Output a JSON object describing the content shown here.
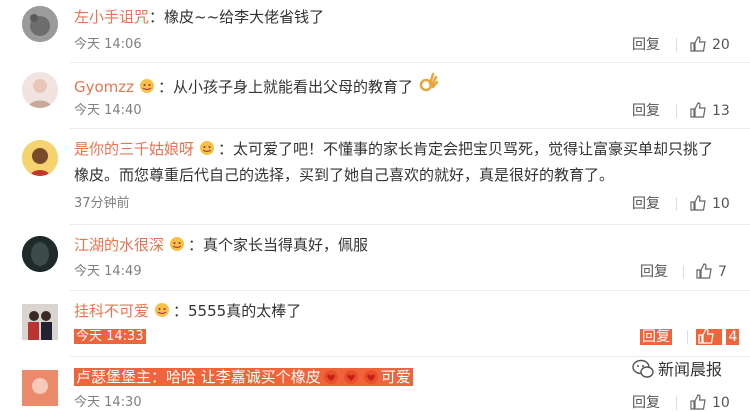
{
  "comments": [
    {
      "name": "左小手诅咒",
      "text": "：橡皮~~给李大佬省钱了",
      "time": "今天 14:06",
      "reply": "回复",
      "likes": "20"
    },
    {
      "name": "Gyomzz",
      "text": "：从小孩子身上就能看出父母的教育了",
      "time": "今天 14:40",
      "reply": "回复",
      "likes": "13"
    },
    {
      "name": "是你的三千姑娘呀",
      "text_line1": "：太可爱了吧！不懂事的家长肯定会把宝贝骂死，觉得让富豪买单却只挑了",
      "text_line2": "橡皮。而您尊重后代自己的选择，买到了她自己喜欢的就好，真是很好的教育了。",
      "time": "37分钟前",
      "reply": "回复",
      "likes": "10"
    },
    {
      "name": "江湖的水很深",
      "text": "：真个家长当得真好，佩服",
      "time": "今天 14:49",
      "reply": "回复",
      "likes": "7"
    },
    {
      "name": "挂科不可爱",
      "text": "：5555真的太棒了",
      "time": "今天 14:33",
      "reply": "回复",
      "likes": "4"
    },
    {
      "name": "卢瑟堡堡主",
      "text_a": "：哈哈 让李嘉诚买个橡皮",
      "text_b": "可爱",
      "time": "今天 14:30",
      "reply": "回复",
      "likes": "10"
    }
  ],
  "watermark": "新闻晨报",
  "colors": {
    "name": "#eb7350",
    "highlight": "#f0643c",
    "meta": "#808080"
  }
}
